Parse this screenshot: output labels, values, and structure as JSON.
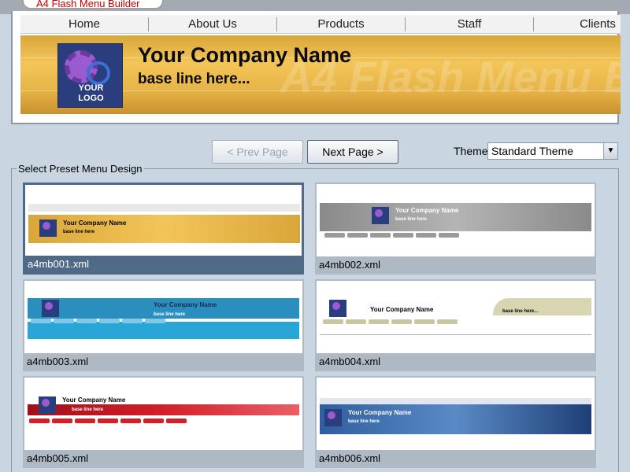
{
  "app": {
    "title": "A4 Flash Menu Builder"
  },
  "preview": {
    "nav_items": [
      "Home",
      "About Us",
      "Products",
      "Staff",
      "Clients"
    ],
    "company_name": "Your Company Name",
    "base_line": "base line here...",
    "watermark": "A4 Flash Menu B",
    "logo_text": "YOUR\nLOGO",
    "banner_color": "#e7b447"
  },
  "controls": {
    "prev_label": "< Prev Page",
    "next_label": "Next Page >",
    "theme_label": "Theme",
    "theme_value": "Standard Theme"
  },
  "gallery": {
    "label": "Select Preset Menu Design",
    "selected": "a4mb001.xml",
    "items": [
      {
        "file": "a4mb001.xml",
        "company": "Your Company Name",
        "base": "base line here",
        "accent": "#e7b447"
      },
      {
        "file": "a4mb002.xml",
        "company": "Your Company Name",
        "base": "base line here",
        "accent": "#9a9a9a"
      },
      {
        "file": "a4mb003.xml",
        "company": "Your Company Name",
        "base": "base line here",
        "accent": "#2aa6d6"
      },
      {
        "file": "a4mb004.xml",
        "company": "Your Company Name",
        "base": "base line here...",
        "accent": "#d8d6b0"
      },
      {
        "file": "a4mb005.xml",
        "company": "Your Company Name",
        "base": "base line here",
        "accent": "#d2202a"
      },
      {
        "file": "a4mb006.xml",
        "company": "Your Company Name",
        "base": "base line here",
        "accent": "#2f5f9e"
      }
    ]
  }
}
